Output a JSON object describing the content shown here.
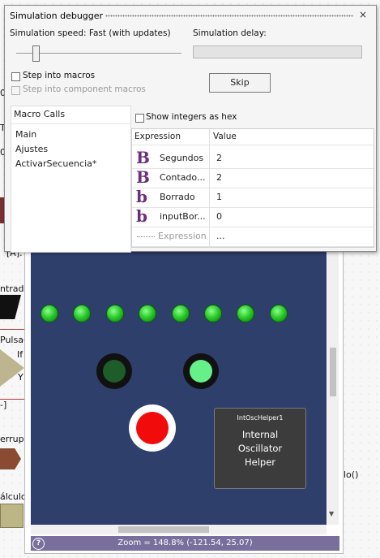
{
  "debugger": {
    "title": "Simulation debugger",
    "close_glyph": "×",
    "speed_label": "Simulation speed: Fast (with updates)",
    "delay_label": "Simulation delay:",
    "step_macros": "Step into macros",
    "step_component_macros": "Step into component macros",
    "skip_button": "Skip",
    "show_hex": "Show integers as hex",
    "macro_calls": {
      "header": "Macro Calls",
      "items": [
        "Main",
        "Ajustes",
        "ActivarSecuencia*"
      ]
    },
    "expressions": {
      "headers": [
        "Expression",
        "Value"
      ],
      "rows": [
        {
          "icon": "B",
          "name": "Segundos",
          "value": "2"
        },
        {
          "icon": "B",
          "name": "Contado...",
          "value": "2"
        },
        {
          "icon": "b",
          "name": "Borrado",
          "value": "1"
        },
        {
          "icon": "b",
          "name": "inputBor...",
          "value": "0"
        }
      ],
      "new_row": {
        "name": "Expression",
        "value": "..."
      }
    }
  },
  "background": {
    "fragments": {
      "tab_t": "T",
      "zero_a": "0",
      "zero_b": "0",
      "a_label": "[A]. L",
      "entrada": "ntrada",
      "pulsad": "Pulsad",
      "if": "If",
      "y": "Y",
      "bracket": "-]",
      "errupc": "errupc",
      "calculo": "álculo",
      "lo": "lo()"
    }
  },
  "simulation": {
    "leds_on": 8,
    "indicator_left": "off",
    "indicator_right": "on",
    "oscillator": {
      "name": "IntOscHelper1",
      "line1": "Internal",
      "line2": "Oscillator",
      "line3": "Helper"
    },
    "zoom_text": "Zoom = 148.8% (-121.54, 25.07)",
    "help_glyph": "?"
  },
  "colors": {
    "canvas": "#2e3f6b",
    "led_green": "#2ecc2e",
    "button_red": "#f20b0b",
    "icon_purple": "#6b2f7e"
  }
}
